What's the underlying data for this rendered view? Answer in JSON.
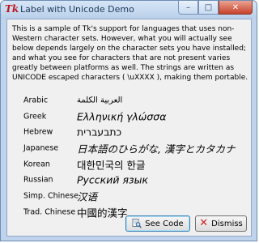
{
  "window": {
    "title": "Label with Unicode Demo",
    "controls": {
      "minimize": "–",
      "maximize": "□",
      "close": "✕"
    }
  },
  "description": "This is a sample of Tk's support for languages that uses non-Western character sets.  However, what you will actually see below depends largely on the character sets you have installed; and what you see for characters that are not present varies greatly between platforms as well. The strings are written as UNICODE escaped characters ( \\uXXXX ), making them portable.",
  "samples": [
    {
      "lang": "Arabic",
      "text": "العربية الكلمة"
    },
    {
      "lang": "Greek",
      "text": "Ελληνική γλώσσα"
    },
    {
      "lang": "Hebrew",
      "text": "כתבעברית"
    },
    {
      "lang": "Japanese",
      "text": "日本語のひらがな, 漢字とカタカナ"
    },
    {
      "lang": "Korean",
      "text": "대한민국의 한글"
    },
    {
      "lang": "Russian",
      "text": "Русский язык"
    },
    {
      "lang": "Simp. Chinese",
      "text": "汉语"
    },
    {
      "lang": "Trad. Chinese",
      "text": "中國的漢字"
    }
  ],
  "buttons": {
    "see_code": "See Code",
    "dismiss": "Dismiss"
  },
  "icons": {
    "app": "tk-feather-icon",
    "see_code": "magnifier-document-icon",
    "dismiss": "red-x-icon"
  }
}
